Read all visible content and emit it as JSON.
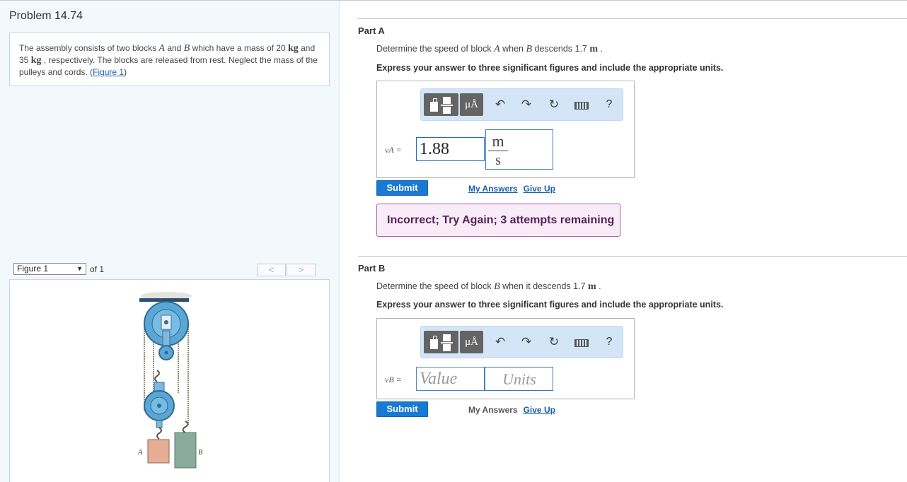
{
  "problem": {
    "title": "Problem 14.74",
    "text_1": "The assembly consists of two blocks ",
    "var_a": "A",
    "text_2": " and ",
    "var_b": "B",
    "text_3": " which have a mass of 20 ",
    "unit_kg1": "kg",
    "text_4": " and 35 ",
    "unit_kg2": "kg",
    "text_5": " , respectively. The blocks are released from rest. Neglect the mass of the pulleys and cords. (",
    "figure_link": "Figure 1",
    "text_6": ")"
  },
  "figure_nav": {
    "selected": "Figure 1",
    "of_label": "of 1",
    "prev": "<",
    "next": ">",
    "label_a": "A",
    "label_b": "B"
  },
  "toolbar": {
    "mu_label": "μÅ",
    "undo": "↶",
    "redo": "↷",
    "reset": "↻",
    "help": "?"
  },
  "part_a": {
    "title": "Part A",
    "question_1": "Determine the speed of block ",
    "question_var": "A",
    "question_2": " when ",
    "question_var2": "B",
    "question_3": " descends 1.7 ",
    "question_unit": "m",
    "question_4": " .",
    "instruction": "Express your answer to three significant figures and include the appropriate units.",
    "var_label": "vA =",
    "value": "1.88",
    "unit_num": "m",
    "unit_den": "s",
    "submit": "Submit",
    "my_answers": "My Answers",
    "give_up": "Give Up",
    "feedback": "Incorrect; Try Again; 3 attempts remaining"
  },
  "part_b": {
    "title": "Part B",
    "question_1": "Determine the speed of block ",
    "question_var": "B",
    "question_2": " when it descends 1.7 ",
    "question_unit": "m",
    "question_3": " .",
    "instruction": "Express your answer to three significant figures and include the appropriate units.",
    "var_label": "vB =",
    "value_placeholder": "Value",
    "units_placeholder": "Units",
    "submit": "Submit",
    "my_answers": "My Answers",
    "give_up": "Give Up"
  }
}
